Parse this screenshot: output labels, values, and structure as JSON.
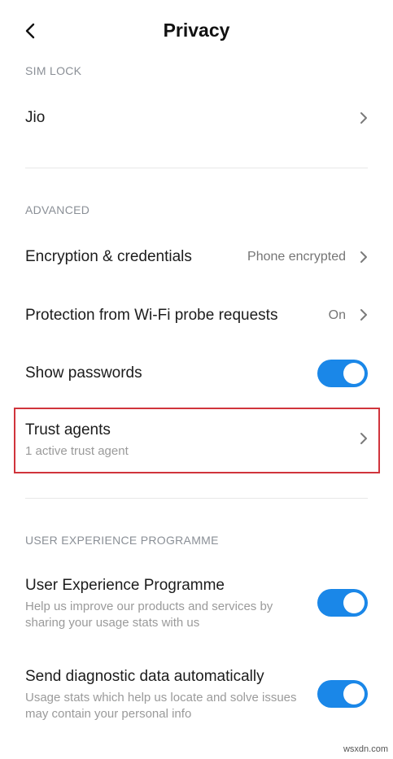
{
  "header": {
    "title": "Privacy",
    "back_icon": "chevron-left-icon"
  },
  "sections": {
    "sim_lock": "SIM LOCK",
    "advanced": "ADVANCED",
    "user_experience": "USER EXPERIENCE PROGRAMME"
  },
  "sim_lock": {
    "jio_label": "Jio"
  },
  "advanced": {
    "encryption": {
      "label": "Encryption & credentials",
      "value": "Phone encrypted"
    },
    "wifi_probe": {
      "label": "Protection from Wi-Fi probe requests",
      "value": "On"
    },
    "show_passwords": {
      "label": "Show passwords",
      "enabled": true
    },
    "trust_agents": {
      "label": "Trust agents",
      "subtitle": "1 active trust agent"
    }
  },
  "user_experience": {
    "programme": {
      "label": "User Experience Programme",
      "subtitle": "Help us improve our products and services by sharing your usage stats with us",
      "enabled": true
    },
    "diagnostics": {
      "label": "Send diagnostic data automatically",
      "subtitle": "Usage stats which help us locate and solve issues may contain your personal info",
      "enabled": true
    }
  },
  "colors": {
    "accent": "#1a87e8",
    "highlight": "#d0343c",
    "section_text": "#8a8f96"
  },
  "watermark": "wsxdn.com"
}
